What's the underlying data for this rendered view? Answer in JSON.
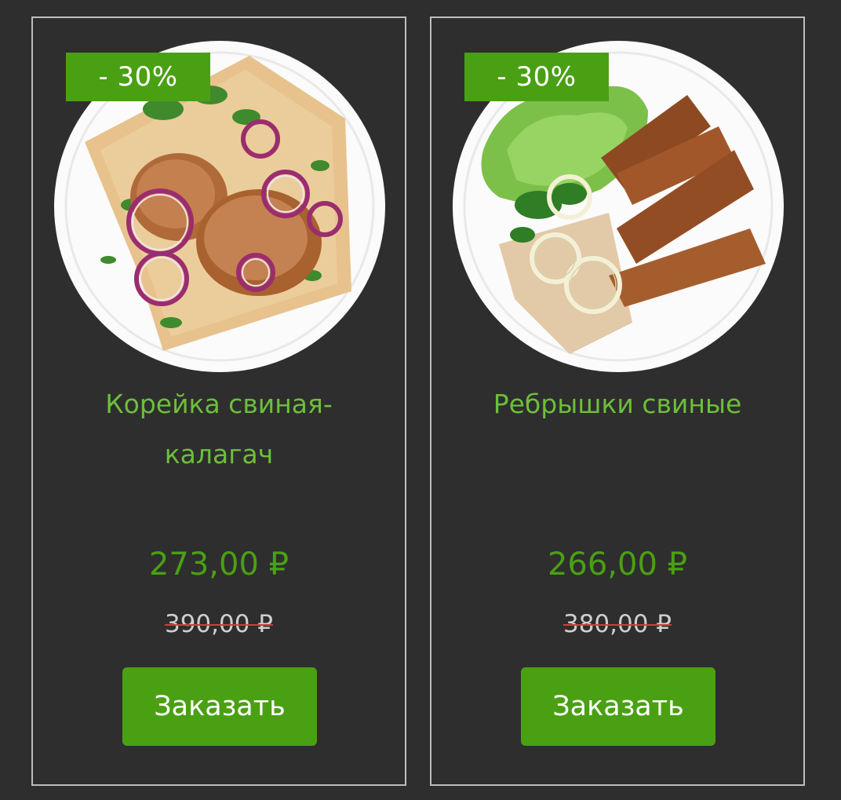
{
  "colors": {
    "background": "#2e2e2e",
    "card_border": "#bdbdbd",
    "accent_green": "#4aa013",
    "title_green": "#6cbf3a",
    "old_price_gray": "#cfcfcf",
    "strike_red": "#d63b3b"
  },
  "products": [
    {
      "image_icon": "pork-loin-on-lavash-plate",
      "discount_badge": "- 30%",
      "title_line1": "Корейка свиная-",
      "title_line2": "калагач",
      "price": "273,00 ₽",
      "old_price": "390,00 ₽",
      "button_label": "Заказать"
    },
    {
      "image_icon": "pork-ribs-plate",
      "discount_badge": "- 30%",
      "title_line1": "Ребрышки свиные",
      "title_line2": "",
      "price": "266,00 ₽",
      "old_price": "380,00 ₽",
      "button_label": "Заказать"
    }
  ]
}
